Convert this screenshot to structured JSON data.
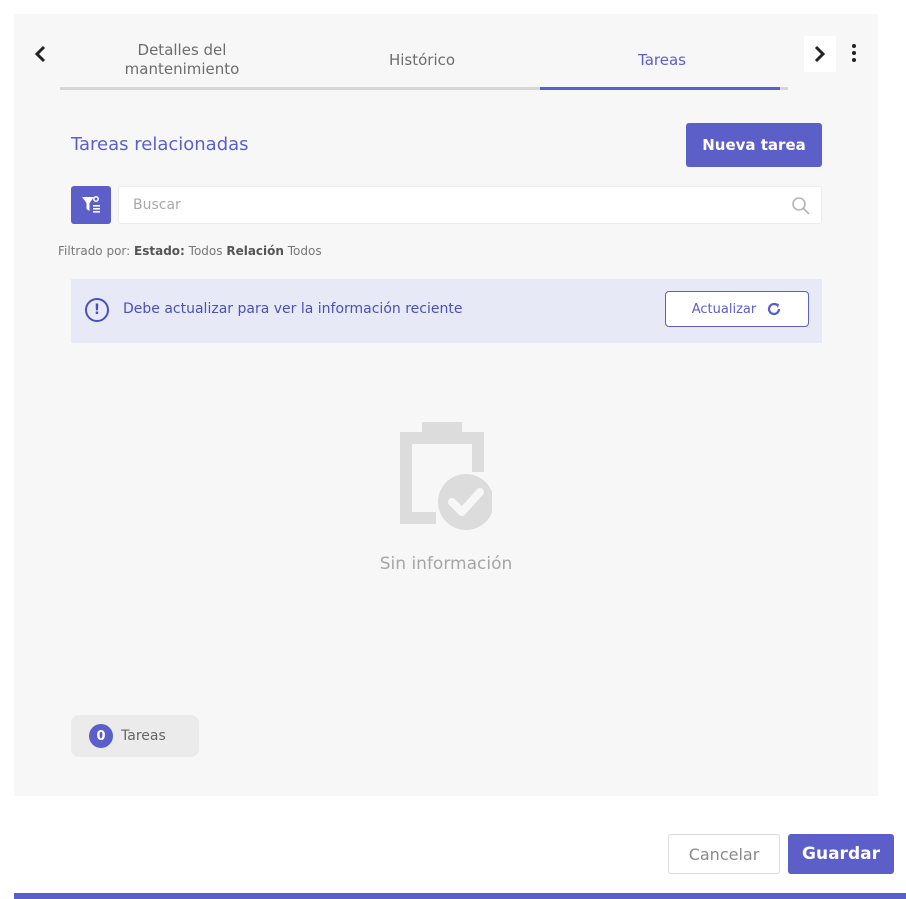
{
  "colors": {
    "accent": "#5b5fc7",
    "panel_bg": "#f7f7f7",
    "alert_bg": "#e8e9f7",
    "muted_text": "#a5a5a5"
  },
  "tabs": {
    "prev_icon": "chevron-left-icon",
    "next_icon": "chevron-right-icon",
    "menu_icon": "more-vertical-icon",
    "items": [
      {
        "label": "Detalles del mantenimiento",
        "active": false
      },
      {
        "label": "Histórico",
        "active": false
      },
      {
        "label": "Tareas",
        "active": true
      }
    ]
  },
  "section": {
    "title": "Tareas relacionadas",
    "new_button": "Nueva tarea"
  },
  "search": {
    "placeholder": "Buscar",
    "value": "",
    "filter_icon": "filter-icon",
    "search_icon": "search-icon"
  },
  "filter_summary": {
    "prefix": "Filtrado por:",
    "estado_label": "Estado:",
    "estado_value": "Todos",
    "relacion_label": "Relación",
    "relacion_value": "Todos"
  },
  "alert": {
    "icon": "alert-circle-icon",
    "message": "Debe actualizar para ver la información reciente",
    "button": "Actualizar",
    "button_icon": "refresh-icon"
  },
  "empty_state": {
    "icon": "clipboard-check-icon",
    "text": "Sin información"
  },
  "counter": {
    "count": "0",
    "label": "Tareas"
  },
  "footer": {
    "cancel": "Cancelar",
    "save": "Guardar"
  }
}
